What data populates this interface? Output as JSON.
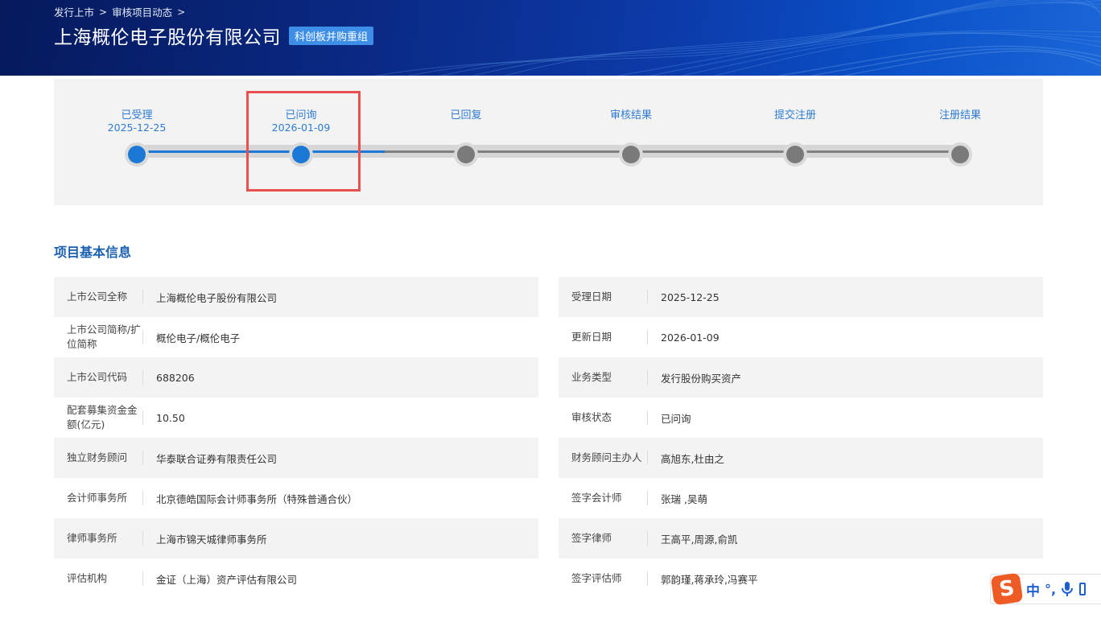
{
  "breadcrumb": [
    "发行上市",
    "审核项目动态"
  ],
  "title": "上海概伦电子股份有限公司",
  "badge": "科创板并购重组",
  "steps": [
    {
      "label": "已受理",
      "date": "2025-12-25",
      "done": true
    },
    {
      "label": "已问询",
      "date": "2026-01-09",
      "done": true
    },
    {
      "label": "已回复",
      "date": "",
      "done": false
    },
    {
      "label": "审核结果",
      "date": "",
      "done": false
    },
    {
      "label": "提交注册",
      "date": "",
      "done": false
    },
    {
      "label": "注册结果",
      "date": "",
      "done": false
    }
  ],
  "section_title": "项目基本信息",
  "left_info": [
    {
      "key": "上市公司全称",
      "value": "上海概伦电子股份有限公司"
    },
    {
      "key": "上市公司简称/扩位简称",
      "value": "概伦电子/概伦电子"
    },
    {
      "key": "上市公司代码",
      "value": "688206"
    },
    {
      "key": "配套募集资金金额(亿元)",
      "value": "10.50"
    },
    {
      "key": "独立财务顾问",
      "value": "华泰联合证券有限责任公司"
    },
    {
      "key": "会计师事务所",
      "value": "北京德皓国际会计师事务所（特殊普通合伙）"
    },
    {
      "key": "律师事务所",
      "value": "上海市锦天城律师事务所"
    },
    {
      "key": "评估机构",
      "value": "金证（上海）资产评估有限公司"
    }
  ],
  "right_info": [
    {
      "key": "受理日期",
      "value": "2025-12-25"
    },
    {
      "key": "更新日期",
      "value": "2026-01-09"
    },
    {
      "key": "业务类型",
      "value": "发行股份购买资产"
    },
    {
      "key": "审核状态",
      "value": "已问询"
    },
    {
      "key": "财务顾问主办人",
      "value": "高旭东,杜由之"
    },
    {
      "key": "签字会计师",
      "value": "张瑞 ,吴萌"
    },
    {
      "key": "签字律师",
      "value": "王高平,周源,俞凯"
    },
    {
      "key": "签字评估师",
      "value": "郭韵瑾,蒋承玲,冯赛平"
    }
  ],
  "ime": {
    "logo": "S",
    "mode": "中",
    "punct": "°,"
  },
  "colors": {
    "accent": "#1b78d4",
    "highlight": "#e85050",
    "banner": "#0a2a86"
  }
}
